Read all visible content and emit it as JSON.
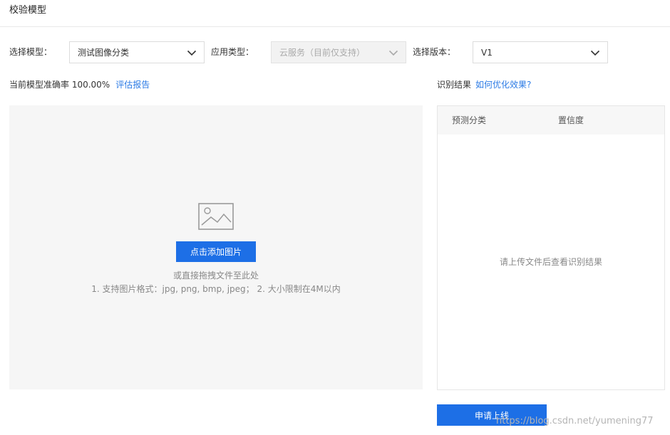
{
  "page": {
    "title": "校验模型"
  },
  "filters": {
    "model": {
      "label": "选择模型：",
      "value": "测试图像分类"
    },
    "app_type": {
      "label": "应用类型：",
      "value": "云服务（目前仅支持）"
    },
    "version": {
      "label": "选择版本：",
      "value": "V1"
    }
  },
  "accuracy": {
    "text": "当前模型准确率 100.00%",
    "link": "评估报告"
  },
  "results": {
    "label": "识别结果",
    "link": "如何优化效果?",
    "col_category": "预测分类",
    "col_confidence": "置信度",
    "empty": "请上传文件后查看识别结果"
  },
  "upload": {
    "button": "点击添加图片",
    "hint_drag": "或直接拖拽文件至此处",
    "hint_rules": "1. 支持图片格式：jpg, png, bmp, jpeg；  2. 大小限制在4M以内"
  },
  "actions": {
    "apply": "申请上线"
  },
  "watermark": "https://blog.csdn.net/yumening77",
  "colors": {
    "primary": "#1d6fe6",
    "link": "#2c7be5",
    "panel_bg": "#f6f6f6"
  },
  "icons": {
    "dropdown": "chevron-down-icon",
    "image": "image-icon"
  }
}
